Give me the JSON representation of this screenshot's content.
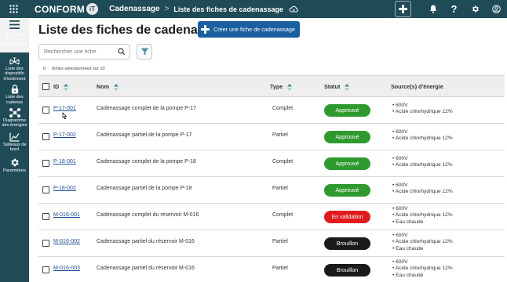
{
  "header": {
    "logo_text": "CONFORM",
    "logo_badge": "iT",
    "breadcrumb_main": "Cadenassage",
    "breadcrumb_sep": ">",
    "breadcrumb_sub": "Liste des fiches de cadenassage",
    "help_label": "?",
    "accent_color": "#1f4b57"
  },
  "sidebar": {
    "items": [
      {
        "label": "Liste des fiches de cadenassage",
        "icon": "hamburger-icon"
      },
      {
        "label": "Liste des dispositifs d'isolement",
        "icon": "isolation-valve-icon"
      },
      {
        "label": "Liste des cadenas",
        "icon": "padlock-icon"
      },
      {
        "label": "Diagramme des énergies",
        "icon": "diagram-icon"
      },
      {
        "label": "Tableaux de bord",
        "icon": "chart-icon"
      },
      {
        "label": "Paramètres",
        "icon": "gear-icon"
      }
    ]
  },
  "main": {
    "title": "Liste des fiches de cadenassage",
    "create_button": "Créer une fiche de cadenassage",
    "search_placeholder": "Rechercher une fiche",
    "selected_count": "0",
    "selected_text": "fiches sélectionnées sur 10"
  },
  "table": {
    "headers": {
      "id": "ID",
      "name": "Nom",
      "type": "Type",
      "status": "Statut",
      "energy": "Source(s) d'énergie"
    },
    "rows": [
      {
        "id": "P-17-001",
        "name": "Cadenassage complet de la pompe P-17",
        "type": "Complet",
        "status": "Approuvé",
        "status_color": "#2e9a2e",
        "energy": [
          "• 600V",
          "• Acide chlorhydrique 12%"
        ]
      },
      {
        "id": "P-17-002",
        "name": "Cadenassage partiel de la pompe P-17",
        "type": "Partiel",
        "status": "Approuvé",
        "status_color": "#2e9a2e",
        "energy": [
          "• 600V",
          "• Acide chlorhydrique 12%"
        ]
      },
      {
        "id": "P-18-001",
        "name": "Cadenassage complet de la pompe P-18",
        "type": "Complet",
        "status": "Approuvé",
        "status_color": "#2e9a2e",
        "energy": [
          "• 600V",
          "• Acide chlorhydrique 12%"
        ]
      },
      {
        "id": "P-18-002",
        "name": "Cadenassage partiel de la pompe P-18",
        "type": "Partiel",
        "status": "Approuvé",
        "status_color": "#2e9a2e",
        "energy": [
          "• 600V",
          "• Acide chlorhydrique 12%"
        ]
      },
      {
        "id": "M-016-001",
        "name": "Cadenassage complet du réservoir M-016",
        "type": "Complet",
        "status": "En validation",
        "status_color": "#e01b1b",
        "energy": [
          "• 600V",
          "• Acide chlorhydrique 12%",
          "• Eau chaude"
        ]
      },
      {
        "id": "M-016-002",
        "name": "Cadenassage partiel du réservoir M-016",
        "type": "Partiel",
        "status": "Brouillon",
        "status_color": "#1a1a1a",
        "energy": [
          "• 600V",
          "• Acide chlorhydrique 12%",
          "• Eau chaude"
        ]
      },
      {
        "id": "M-016-003",
        "name": "Cadenassage partiel du réservoir M-016",
        "type": "Partiel",
        "status": "Brouillon",
        "status_color": "#1a1a1a",
        "energy": [
          "• 600V",
          "• Acide chlorhydrique 12%",
          "• Eau chaude"
        ]
      }
    ]
  }
}
